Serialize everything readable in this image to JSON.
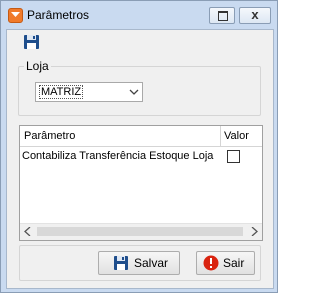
{
  "window": {
    "title": "Parâmetros",
    "restore_glyph": "restore-icon",
    "close_glyph": "x"
  },
  "toolbar": {
    "save_icon": "floppy-disk-icon"
  },
  "loja": {
    "label": "Loja",
    "selected": "MATRIZ"
  },
  "grid": {
    "columns": [
      "Parâmetro",
      "Valor"
    ],
    "rows": [
      {
        "parametro": "Contabiliza Transferência Estoque Loja",
        "valor": false
      }
    ]
  },
  "buttons": {
    "save_label": "Salvar",
    "exit_label": "Sair"
  },
  "colors": {
    "title_bar": "#c9daf0",
    "app_icon": "#f07a2a",
    "exit_icon": "#d9230f"
  }
}
